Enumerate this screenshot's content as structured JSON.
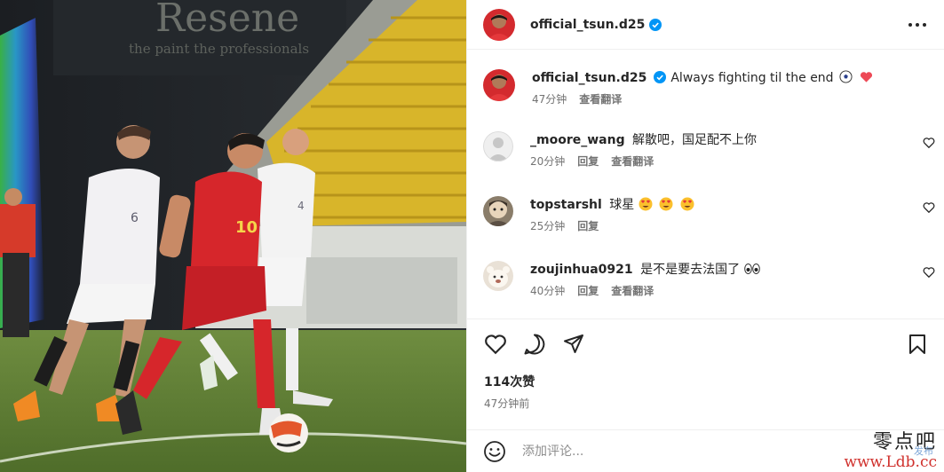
{
  "post_image": {
    "banner_brand": "Resene",
    "banner_tagline": "the paint the professionals",
    "jersey_numbers": {
      "white_left": "6",
      "red_center": "10",
      "white_right": "4"
    }
  },
  "header": {
    "username": "official_tsun.d25",
    "verified": true,
    "more_icon": "more-horizontal-icon"
  },
  "caption": {
    "username": "official_tsun.d25",
    "text": "Always fighting til the end",
    "emojis": [
      "soccer-ball",
      "red-heart"
    ],
    "time": "47分钟",
    "translate": "查看翻译"
  },
  "comments": [
    {
      "username": "_moore_wang",
      "text": "解散吧，国足配不上你",
      "time": "20分钟",
      "reply": "回复",
      "translate": "查看翻译",
      "avatar": "default-gray"
    },
    {
      "username": "topstarshl",
      "text": "球星",
      "emojis": [
        "heart-eyes",
        "heart-eyes",
        "heart-eyes"
      ],
      "time": "25分钟",
      "reply": "回复",
      "avatar": "character"
    },
    {
      "username": "zoujinhua0921",
      "text": "是不是要去法国了",
      "emojis": [
        "eyes"
      ],
      "time": "40分钟",
      "reply": "回复",
      "translate": "查看翻译",
      "avatar": "plush"
    }
  ],
  "actions": {
    "like": "heart-icon",
    "comment": "comment-icon",
    "share": "send-icon",
    "save": "bookmark-icon"
  },
  "likes": "114次赞",
  "posted": "47分钟前",
  "composer": {
    "placeholder": "添加评论...",
    "post_label": "发布"
  },
  "watermark": {
    "line1": "零点吧",
    "line2": "www.Ldb.cc"
  },
  "colors": {
    "verified": "#0095f6",
    "heart": "#ed4956",
    "muted": "#737373",
    "text": "#262626",
    "post": "#b2dffc",
    "red_jersey": "#d6262b"
  }
}
